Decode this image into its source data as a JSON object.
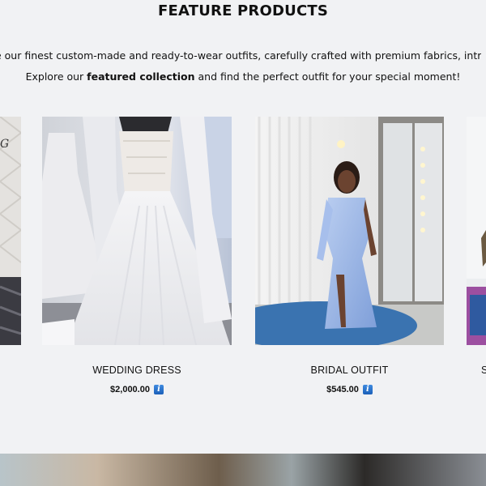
{
  "section": {
    "title": "FEATURE PRODUCTS",
    "intro_line1": "e our finest custom-made and ready-to-wear outfits, carefully crafted with premium fabrics, intric",
    "intro_line2_pre": "Explore our ",
    "intro_line2_bold": "featured collection",
    "intro_line2_post": " and find the perfect outfit for your special moment!"
  },
  "products": [
    {
      "name": "",
      "price": "",
      "partial": "left"
    },
    {
      "name": "WEDDING DRESS",
      "price": "$2,000.00",
      "info_icon": "info-icon"
    },
    {
      "name": "BRIDAL OUTFIT",
      "price": "$545.00",
      "info_icon": "info-icon"
    },
    {
      "name": "S",
      "price": "",
      "partial": "right"
    }
  ],
  "colors": {
    "background": "#f1f2f4",
    "info_icon": "#1a5fb8"
  }
}
